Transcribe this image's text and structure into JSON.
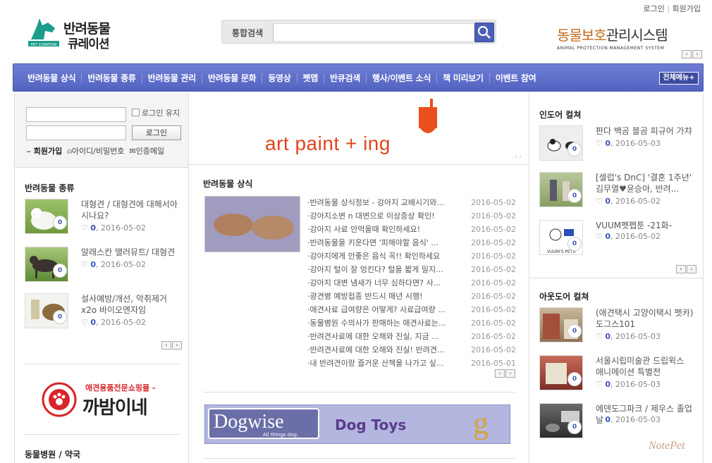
{
  "header": {
    "top_links": [
      "로그인",
      "회원가입"
    ],
    "logo": {
      "line1": "반려동물",
      "line2": "큐레이션",
      "sub": "PET CURATION"
    },
    "search": {
      "label": "통합검색",
      "placeholder": ""
    },
    "aps": {
      "green": "동물보호",
      "dark": "관리시스템",
      "sub": "ANIMAL PROTECTION MANAGEMENT SYSTEM"
    }
  },
  "nav": {
    "items": [
      "반려동물 상식",
      "반려동물 종류",
      "반려동물 관리",
      "반려동물 문화",
      "동영상",
      "펫맵",
      "반큐검색",
      "행사/이벤트 소식",
      "책 미리보기",
      "이벤트 참여"
    ],
    "all_menu": "전체메뉴"
  },
  "login": {
    "keep": "로그인 유지",
    "button": "로그인",
    "join": "회원가입",
    "find": "아이디/비밀번호",
    "verify": "인증메일"
  },
  "kinds": {
    "title": "반려동물 종류",
    "items": [
      {
        "title": "대형견 / 대형견에 대해서아시나요?",
        "count": "0",
        "date": "2016-05-02"
      },
      {
        "title": "알래스칸 맬러뮤트/ 대형견",
        "count": "0",
        "date": "2016-05-02"
      },
      {
        "title": "설사예방/개선, 악취제거 x2o 바이오엔자임",
        "count": "0",
        "date": "2016-05-02"
      }
    ]
  },
  "kkabam": {
    "top": "애견용품전문쇼핑몰 -",
    "name": "까밤이네"
  },
  "hospital": {
    "title": "동물병원 / 약국"
  },
  "art_banner": {
    "text": "art paint + ing"
  },
  "knowledge": {
    "title": "반려동물 상식",
    "rows": [
      {
        "t": "·반려동물 상식정보 - 강아지 교배시기와...",
        "d": "2016-05-02"
      },
      {
        "t": "·강아지소변 n 대변으로 이상증상 확인!",
        "d": "2016-05-02"
      },
      {
        "t": "·강아지 사료 안먹을때 확인하세요!",
        "d": "2016-05-02"
      },
      {
        "t": "·반려동물을 키운다면 '피해야할 음식' ...",
        "d": "2016-05-02"
      },
      {
        "t": "·강아지에게 안좋은 음식 꼭!! 확인하세요",
        "d": "2016-05-02"
      },
      {
        "t": "·강아지 털이 잘 엉킨다? 털을 짧게 밀지...",
        "d": "2016-05-02"
      },
      {
        "t": "·강아지 대변 냄새가 너무 심하다면? 사...",
        "d": "2016-05-02"
      },
      {
        "t": "·광견병 예방접종 반드시 매년 시행!",
        "d": "2016-05-02"
      },
      {
        "t": "·애견사료 급여량은 어떻게? 사료급여량 ...",
        "d": "2016-05-02"
      },
      {
        "t": "·동물병원 수의사가 판매하는 애견사료는...",
        "d": "2016-05-02"
      },
      {
        "t": "·반려견사료에 대한 오해와 진실, 지금 ...",
        "d": "2016-05-02"
      },
      {
        "t": "·반려견사료에 대한 오해와 진실! 반려견...",
        "d": "2016-05-02"
      },
      {
        "t": "·내 반려견이랑 즐거운 산책을 나가고 싶...",
        "d": "2016-05-01"
      }
    ]
  },
  "dogwise": {
    "name": "Dogwise",
    "tag": "All things dog.",
    "toys": "Dog Toys"
  },
  "indoor": {
    "title": "인도어 컬쳐",
    "items": [
      {
        "title": "판다 백곰 블곰 피규어 가챠",
        "count": "0",
        "date": "2016-05-03"
      },
      {
        "title": "[셀럽's DnC] '결혼 1주년' 김무열♥윤승아, 반려...",
        "count": "0",
        "date": "2016-05-02"
      },
      {
        "title": "VUUM펫펩툰 -21화-",
        "count": "0",
        "date": "2016-05-02"
      }
    ]
  },
  "outdoor": {
    "title": "아웃도어 컬쳐",
    "items": [
      {
        "title": "(애견택시 고양이택시 펫카) 도그스101",
        "count": "0",
        "date": "2016-05-03"
      },
      {
        "title": "서울시립미술관 드립윅스 애니메이션 특별전",
        "count": "0",
        "date": "2016-05-03"
      },
      {
        "title": "에덴도그파크 / 제우스 졸업날",
        "count": "0",
        "date": "2016-05-03"
      }
    ]
  },
  "watermark": "NotePet"
}
